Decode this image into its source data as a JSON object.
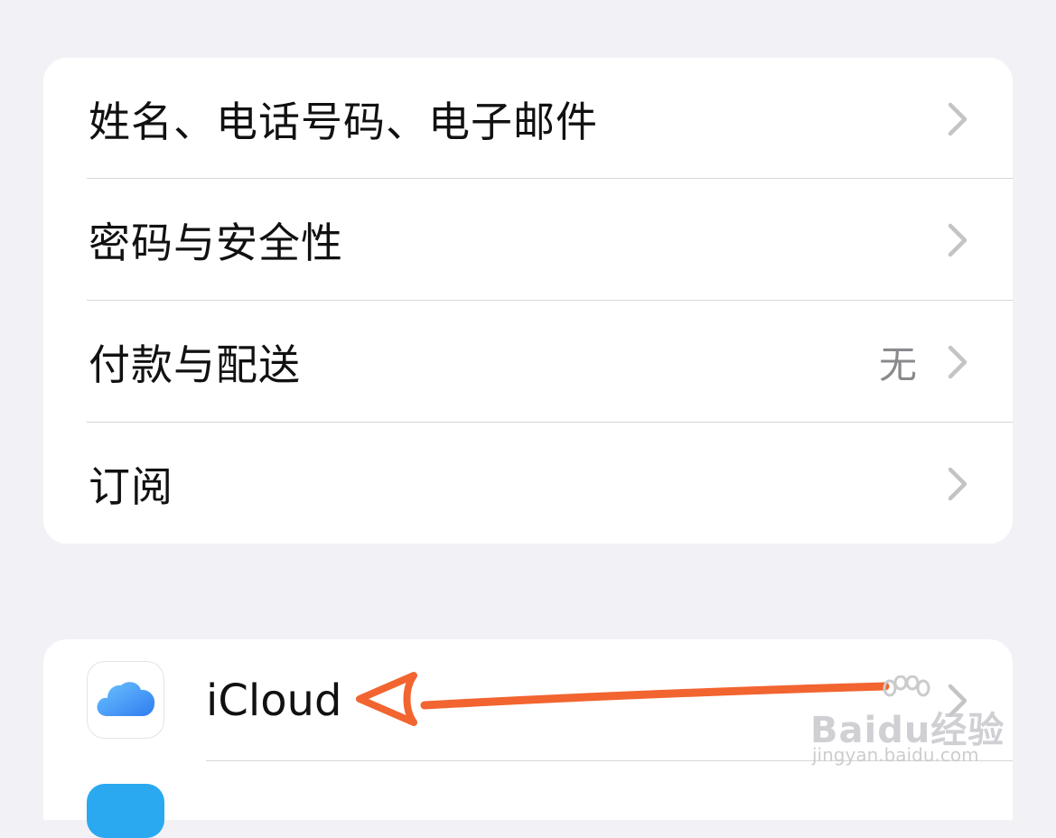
{
  "account_group": {
    "items": [
      {
        "label": "姓名、电话号码、电子邮件",
        "value": ""
      },
      {
        "label": "密码与安全性",
        "value": ""
      },
      {
        "label": "付款与配送",
        "value": "无"
      },
      {
        "label": "订阅",
        "value": ""
      }
    ]
  },
  "services_group": {
    "items": [
      {
        "label": "iCloud",
        "icon": "icloud-icon"
      }
    ]
  },
  "icons": {
    "chevron": "chevron-right-icon",
    "icloud": "icloud-icon"
  },
  "annotation": {
    "type": "arrow",
    "color": "#f26430"
  },
  "watermark": {
    "brand": "Baidu经验",
    "url": "jingyan.baidu.com"
  },
  "colors": {
    "background": "#f2f2f6",
    "card": "#ffffff",
    "separator": "#d6d6d8",
    "chevron": "#c4c4c7",
    "secondary_text": "#8a8a8e",
    "icloud_blue": "#3b8ff5"
  }
}
